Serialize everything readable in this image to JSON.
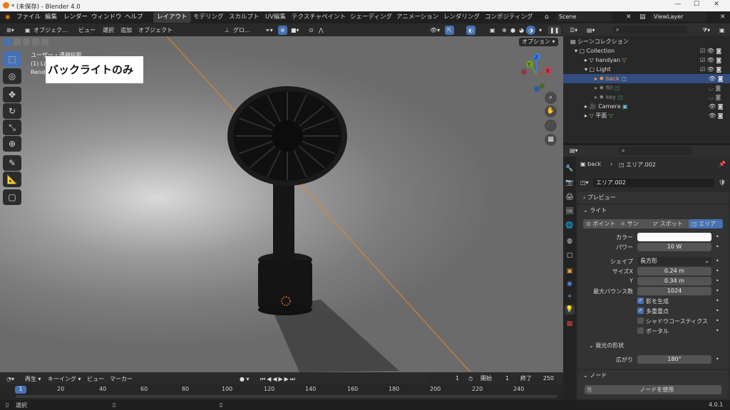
{
  "title_bar": {
    "title": "* (未保存) - Blender 4.0"
  },
  "menu": [
    "ファイル",
    "編集",
    "レンダー",
    "ウィンドウ",
    "ヘルプ"
  ],
  "workspaces": [
    "レイアウト",
    "モデリング",
    "スカルプト",
    "UV編集",
    "テクスチャペイント",
    "シェーディング",
    "アニメーション",
    "レンダリング",
    "コンポジティング"
  ],
  "scene": "Scene",
  "view_layer": "ViewLayer",
  "viewport_header": {
    "mode": "オブジェク...",
    "items": [
      "ビュー",
      "選択",
      "追加",
      "オブジェクト"
    ],
    "transform": "グロ..."
  },
  "viewport": {
    "options": "オプション",
    "info_line1": "ユーザー・透視投影",
    "info_line2": "(1) Li",
    "info_line3": "Rende",
    "caption": "バックライトのみ",
    "axes": {
      "x": "X",
      "y": "Y",
      "z": "Z"
    }
  },
  "timeline_header": {
    "playback": "再生",
    "keying": "キーイング",
    "view": "ビュー",
    "marker": "マーカー",
    "current": "1",
    "start_label": "開始",
    "start": "1",
    "end_label": "終了",
    "end": "250"
  },
  "timeline": {
    "current_frame": "1",
    "ticks": [
      "20",
      "40",
      "60",
      "80",
      "100",
      "120",
      "140",
      "160",
      "180",
      "200",
      "220",
      "240"
    ]
  },
  "status": {
    "left": "選択",
    "version": "4.0.1"
  },
  "outliner": {
    "root": "シーンコレクション",
    "rows": [
      "Collection",
      "handyan",
      "Light",
      "back",
      "fill",
      "key",
      "Camera",
      "平面"
    ]
  },
  "properties": {
    "breadcrumb_obj": "back",
    "breadcrumb_data": "エリア.002",
    "datablock": "エリア.002",
    "preview": "プレビュー",
    "light": "ライト",
    "types": [
      "ポイント",
      "サン",
      "スポット",
      "エリア"
    ],
    "color_label": "カラー",
    "power_label": "パワー",
    "power": "10 W",
    "shape_label": "シェイプ",
    "shape": "長方形",
    "sizex_label": "サイズX",
    "sizex": "0.24 m",
    "y_label": "Y",
    "y": "0.34 m",
    "bounces_label": "最大バウンス数",
    "bounces": "1024",
    "cast_shadow": "影を生成",
    "mis": "多重重点",
    "caustics": "シャドウコースティクス",
    "portal": "ポータル",
    "beam": "発光の形状",
    "spread_label": "広がり",
    "spread": "180°",
    "nodes": "ノード",
    "use_nodes": "ノードを使用"
  }
}
